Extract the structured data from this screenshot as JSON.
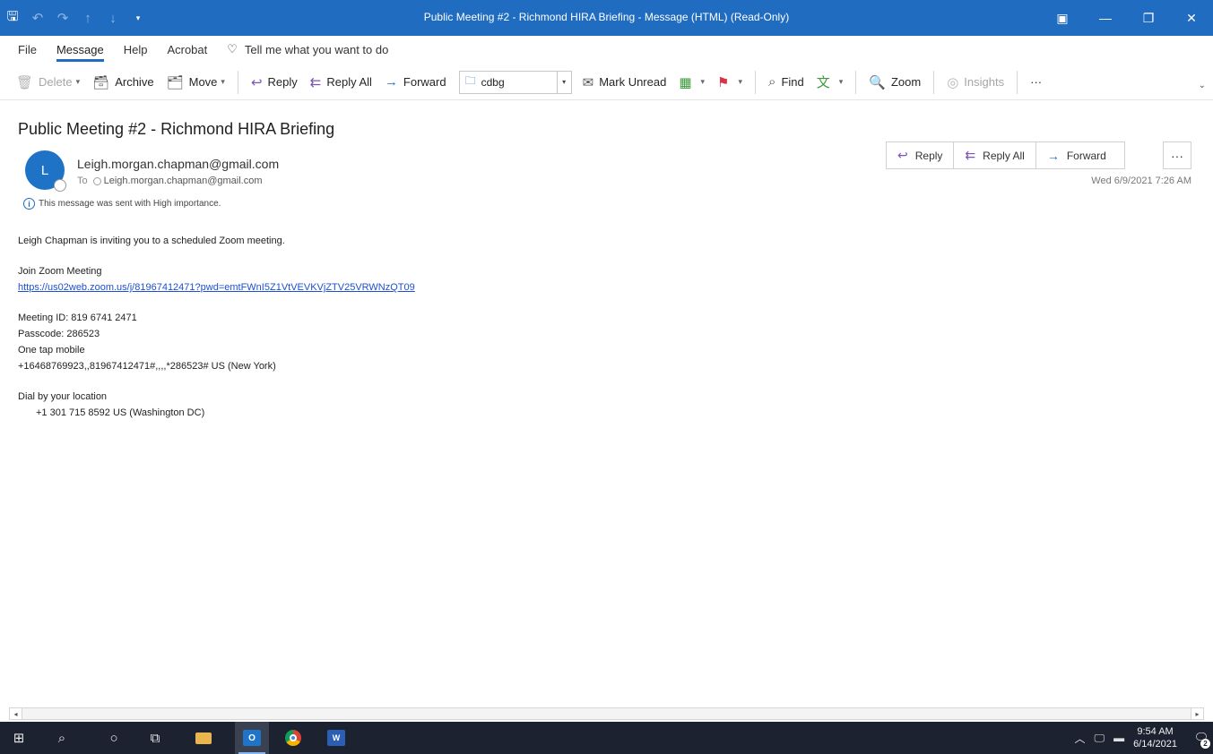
{
  "window": {
    "title": "Public Meeting #2 - Richmond HIRA Briefing  -  Message (HTML) (Read-Only)",
    "quick_access_icons": [
      "save-icon",
      "undo-icon",
      "redo-icon",
      "up-icon",
      "down-icon",
      "customize-icon"
    ],
    "controls": [
      "ribbon-display-icon",
      "minimize-icon",
      "restore-icon",
      "close-icon"
    ]
  },
  "menu": {
    "tabs": [
      "File",
      "Message",
      "Help",
      "Acrobat"
    ],
    "active_tab": "Message",
    "tell_me": "Tell me what you want to do"
  },
  "ribbon": {
    "delete": "Delete",
    "archive": "Archive",
    "move": "Move",
    "reply": "Reply",
    "reply_all": "Reply All",
    "forward": "Forward",
    "quick_step_value": "cdbg",
    "mark_unread": "Mark Unread",
    "find": "Find",
    "zoom": "Zoom",
    "insights": "Insights",
    "more": "···"
  },
  "message": {
    "subject": "Public Meeting #2 - Richmond HIRA Briefing",
    "avatar_initial": "L",
    "sender": "Leigh.morgan.chapman@gmail.com",
    "to_label": "To",
    "to_address": "Leigh.morgan.chapman@gmail.com",
    "importance_note": "This message was sent with High importance.",
    "datetime": "Wed 6/9/2021 7:26 AM",
    "actions": {
      "reply": "Reply",
      "reply_all": "Reply All",
      "forward": "Forward",
      "more": "···"
    }
  },
  "body": {
    "invite": "Leigh Chapman is inviting you to a scheduled Zoom meeting.",
    "join_heading": "Join Zoom Meeting",
    "join_link": "https://us02web.zoom.us/j/81967412471?pwd=emtFWnI5Z1VtVEVKVjZTV25VRWNzQT09",
    "meeting_id": "Meeting ID: 819 6741 2471",
    "passcode": "Passcode: 286523",
    "one_tap": "One tap mobile",
    "one_tap_number": "+16468769923,,81967412471#,,,,*286523# US (New York)",
    "dial_heading": "Dial by your location",
    "dial_number": "+1 301 715 8592 US (Washington DC)"
  },
  "taskbar": {
    "apps": [
      "windows-start-icon",
      "search-icon",
      "cortana-icon",
      "task-view-icon",
      "file-explorer-icon",
      "outlook-icon",
      "chrome-icon",
      "word-icon"
    ],
    "time": "9:54 AM",
    "date": "6/14/2021",
    "notification_count": "2"
  }
}
